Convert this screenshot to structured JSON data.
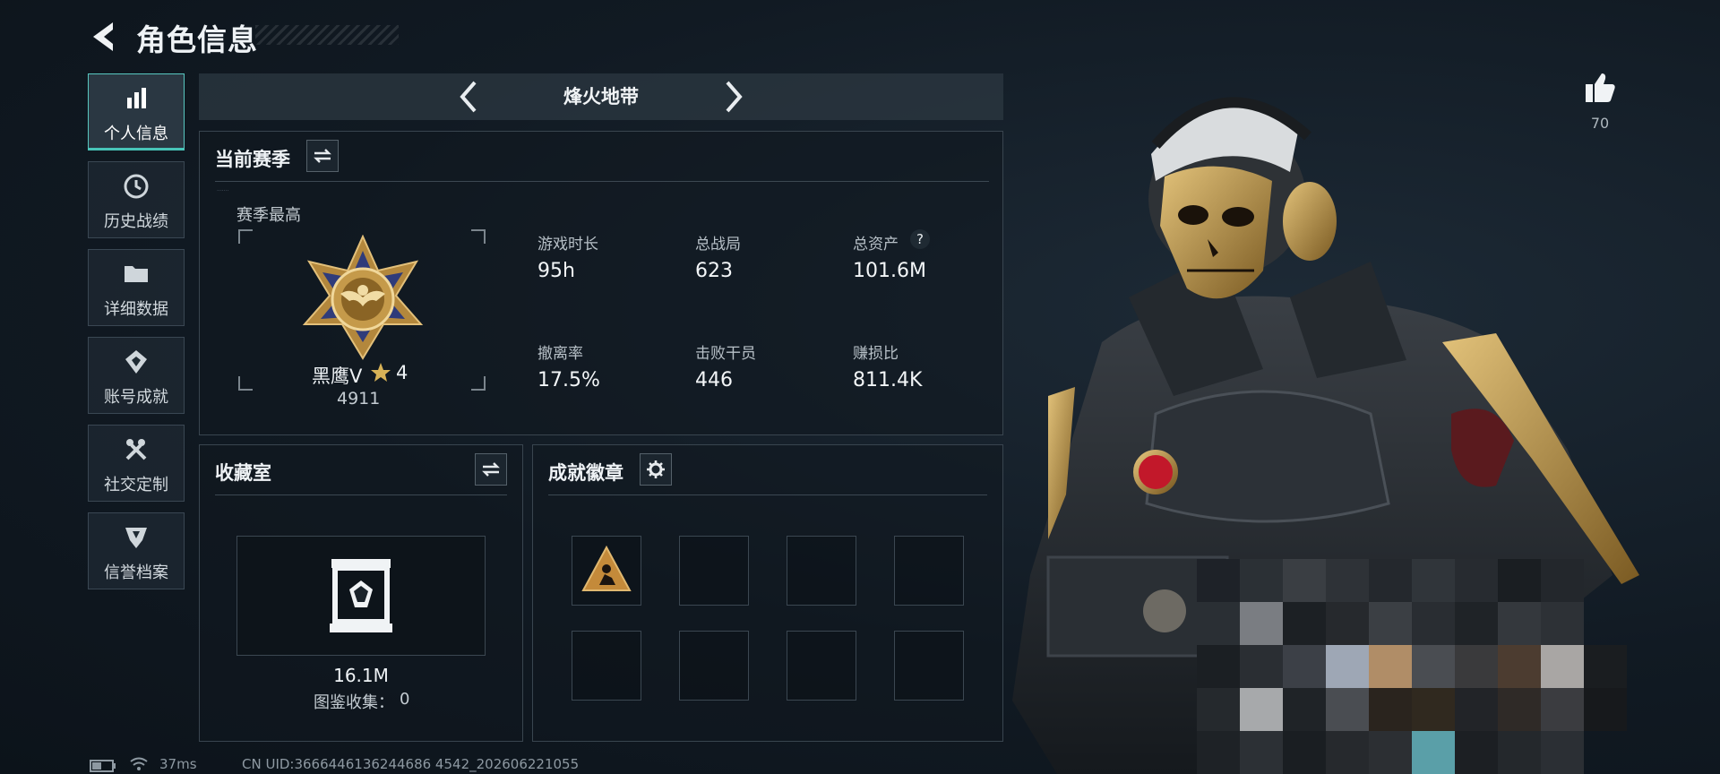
{
  "header": {
    "title": "角色信息"
  },
  "sidebar": {
    "items": [
      {
        "label": "个人信息",
        "icon": "bar-chart-icon",
        "active": true
      },
      {
        "label": "历史战绩",
        "icon": "history-clock-icon",
        "active": false
      },
      {
        "label": "详细数据",
        "icon": "folder-icon",
        "active": false
      },
      {
        "label": "账号成就",
        "icon": "achievement-icon",
        "active": false
      },
      {
        "label": "社交定制",
        "icon": "tools-icon",
        "active": false
      },
      {
        "label": "信誉档案",
        "icon": "shield-icon",
        "active": false
      }
    ]
  },
  "mode": {
    "label": "烽火地带"
  },
  "season": {
    "title": "当前赛季",
    "best_label": "赛季最高",
    "rank_name": "黑鹰V",
    "rank_stars": "4",
    "rank_score": "4911",
    "stats": [
      {
        "label": "游戏时长",
        "value": "95h"
      },
      {
        "label": "总战局",
        "value": "623"
      },
      {
        "label": "总资产",
        "value": "101.6M",
        "help": "?"
      },
      {
        "label": "撤离率",
        "value": "17.5%"
      },
      {
        "label": "击败干员",
        "value": "446"
      },
      {
        "label": "赚损比",
        "value": "811.4K"
      }
    ]
  },
  "collection": {
    "title": "收藏室",
    "value": "16.1M",
    "catalog_label": "图鉴收集：",
    "catalog_value": "0"
  },
  "badges": {
    "title": "成就徽章"
  },
  "likes": {
    "count": "70"
  },
  "status": {
    "ping": "37ms",
    "uid": "CN UID:3666446136244686 4542_202606221055"
  },
  "colors": {
    "accent": "#48c4b8",
    "gold": "#c9a24a",
    "panel_border": "#39454f"
  }
}
